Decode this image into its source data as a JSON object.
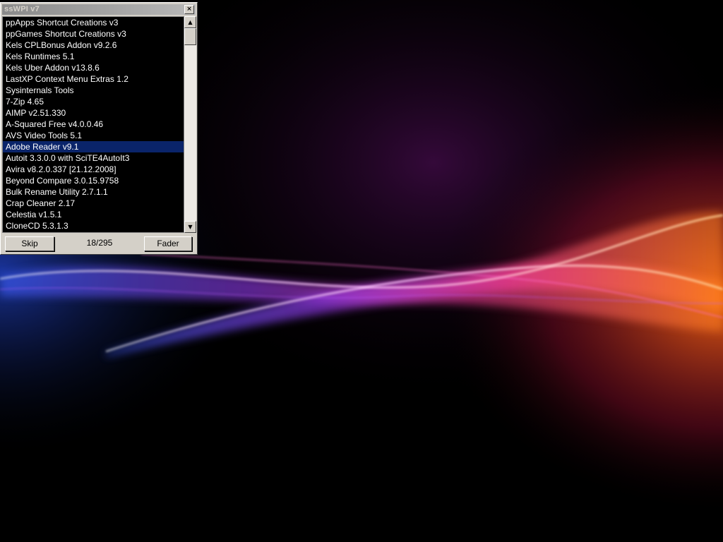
{
  "window": {
    "title": "ssWPI v7",
    "close_glyph": "×"
  },
  "list": {
    "selected_index": 11,
    "items": [
      "ppApps Shortcut Creations v3",
      "ppGames Shortcut Creations v3",
      "Kels CPLBonus Addon v9.2.6",
      "Kels Runtimes 5.1",
      "Kels Uber Addon v13.8.6",
      "LastXP Context Menu Extras 1.2",
      "Sysinternals Tools",
      "7-Zip 4.65",
      "AIMP v2.51.330",
      "A-Squared Free v4.0.0.46",
      "AVS Video Tools 5.1",
      "Adobe Reader v9.1",
      "Autoit 3.3.0.0 with SciTE4AutoIt3",
      "Avira v8.2.0.337 [21.12.2008]",
      "Beyond Compare 3.0.15.9758",
      "Bulk Rename Utility 2.7.1.1",
      "Crap Cleaner 2.17",
      "Celestia v1.5.1",
      "CloneCD 5.3.1.3"
    ]
  },
  "scrollbar": {
    "up_glyph": "▲",
    "down_glyph": "▼"
  },
  "footer": {
    "skip_label": "Skip",
    "progress": "18/295",
    "fader_label": "Fader"
  },
  "colors": {
    "selection": "#0a246a",
    "list_bg": "#000000",
    "window_face": "#d4d0c8"
  }
}
